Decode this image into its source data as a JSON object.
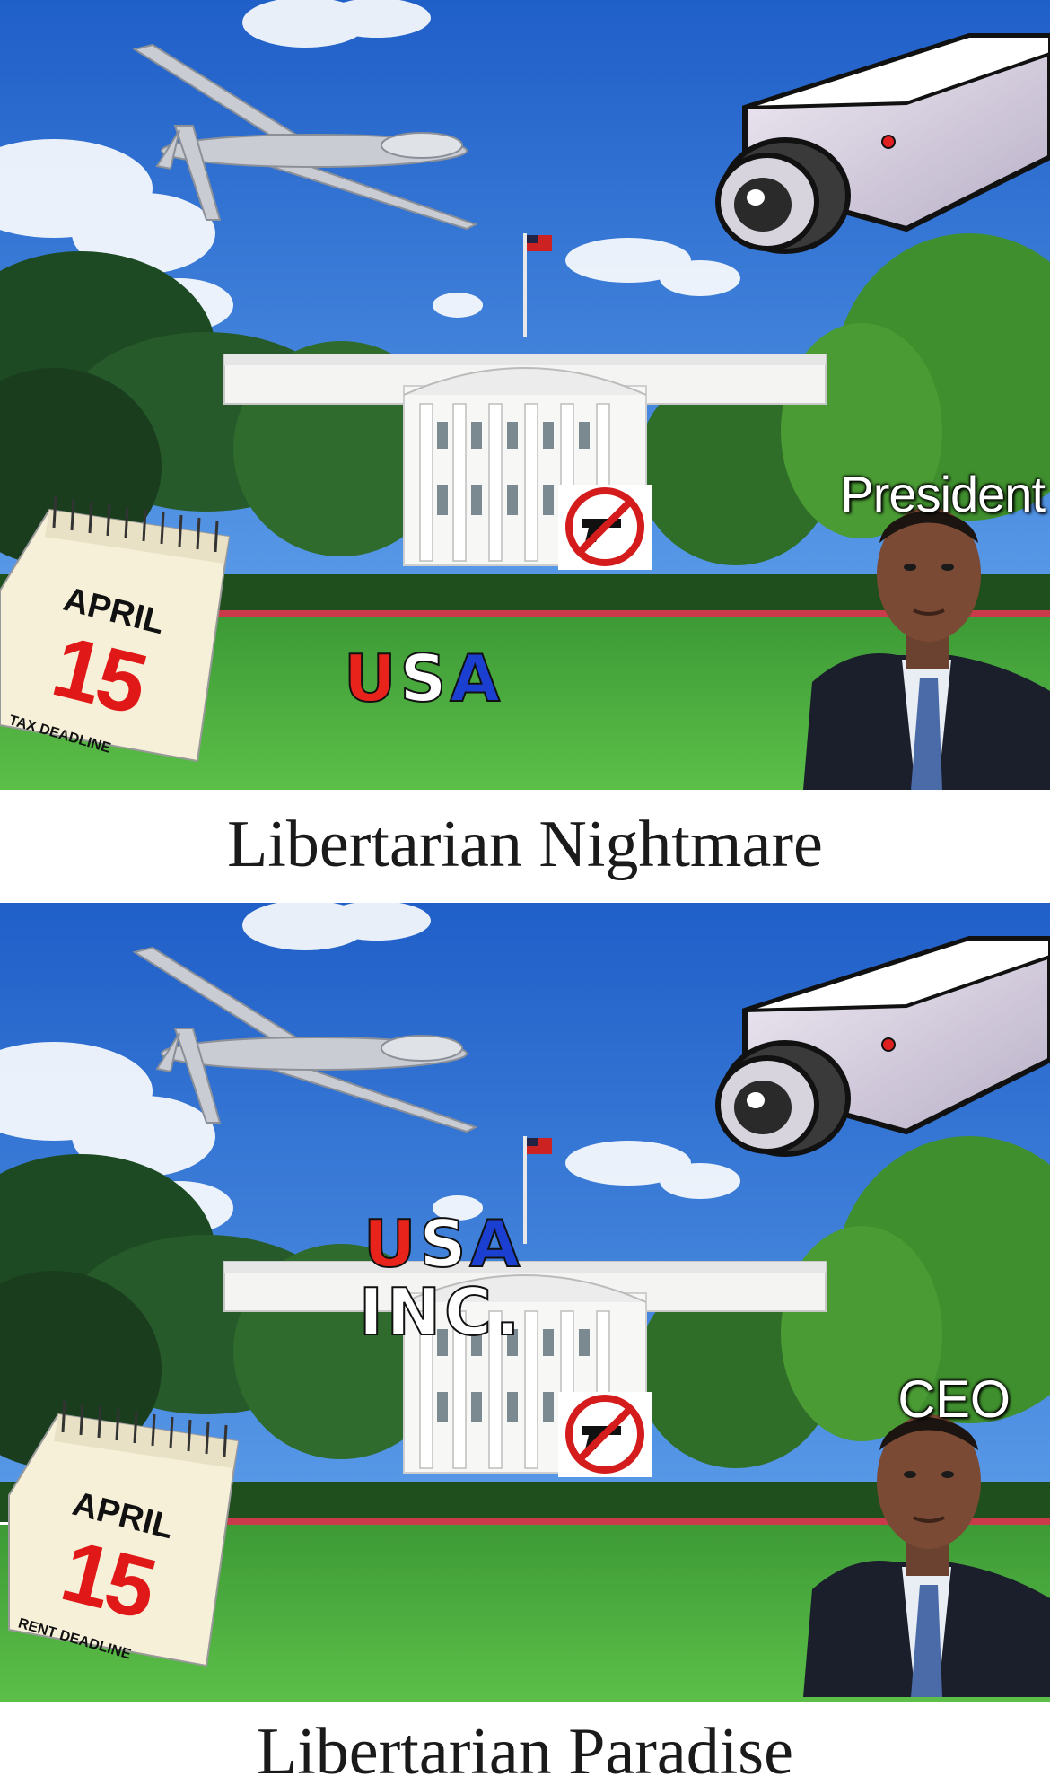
{
  "panels": [
    {
      "role_label": "President",
      "logo_text": "USA",
      "logo_letters": [
        "U",
        "S",
        "A"
      ],
      "calendar": {
        "month": "APRIL",
        "day": "15",
        "note": "TAX DEADLINE"
      },
      "caption": "Libertarian Nightmare"
    },
    {
      "role_label": "CEO",
      "logo_text": "USA",
      "logo_letters": [
        "U",
        "S",
        "A"
      ],
      "logo_sub": "INC.",
      "calendar": {
        "month": "APRIL",
        "day": "15",
        "note": "RENT DEADLINE"
      },
      "caption": "Libertarian Paradise"
    }
  ],
  "colors": {
    "sky": "#2f74d8",
    "lawn": "#3fa83a",
    "hedge": "#1f4f1c",
    "usa_red": "#e8231c",
    "usa_blue": "#1a3fd1",
    "calendar_red": "#e01818"
  },
  "icons": [
    "drone-icon",
    "security-camera-icon",
    "white-house-icon",
    "no-guns-sign-icon",
    "flag-icon",
    "person-in-suit-icon"
  ]
}
